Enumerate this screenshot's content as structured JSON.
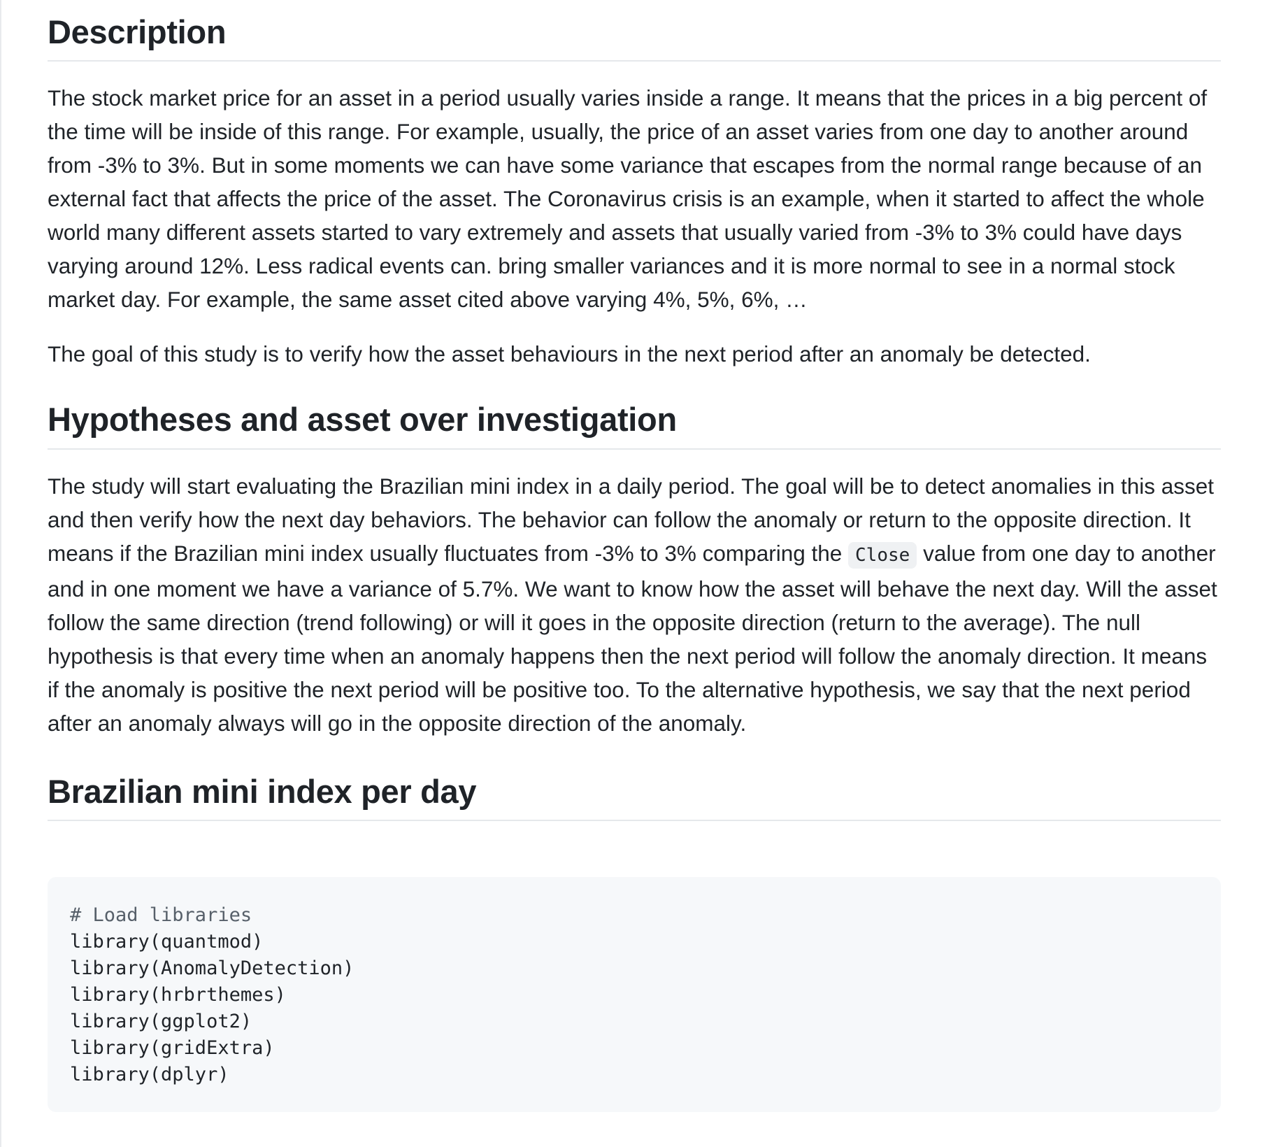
{
  "sections": {
    "description": {
      "title": "Description",
      "paragraphs": [
        "The stock market price for an asset in a period usually varies inside a range. It means that the prices in a big percent of the time will be inside of this range. For example, usually, the price of an asset varies from one day to another around from -3% to 3%. But in some moments we can have some variance that escapes from the normal range because of an external fact that affects the price of the asset. The Coronavirus crisis is an example, when it started to affect the whole world many different assets started to vary extremely and assets that usually varied from -3% to 3% could have days varying around 12%. Less radical events can. bring smaller variances and it is more normal to see in a normal stock market day. For example, the same asset cited above varying 4%, 5%, 6%, …",
        "The goal of this study is to verify how the asset behaviours in the next period after an anomaly be detected."
      ]
    },
    "hypotheses": {
      "title": "Hypotheses and asset over investigation",
      "paragraph_before_code": "The study will start evaluating the Brazilian mini index in a daily period. The goal will be to detect anomalies in this asset and then verify how the next day behaviors. The behavior can follow the anomaly or return to the opposite direction. It means if the Brazilian mini index usually fluctuates from -3% to 3% comparing the ",
      "inline_code": "Close",
      "paragraph_after_code": " value from one day to another and in one moment we have a variance of 5.7%. We want to know how the asset will behave the next day. Will the asset follow the same direction (trend following) or will it goes in the opposite direction (return to the average). The null hypothesis is that every time when an anomaly happens then the next period will follow the anomaly direction. It means if the anomaly is positive the next period will be positive too. To the alternative hypothesis, we say that the next period after an anomaly always will go in the opposite direction of the anomaly."
    },
    "mini_index": {
      "title": "Brazilian mini index per day",
      "code": {
        "comment": "# Load libraries",
        "lines": [
          "library(quantmod)",
          "library(AnomalyDetection)",
          "library(hrbrthemes)",
          "library(ggplot2)",
          "library(gridExtra)",
          "library(dplyr)"
        ]
      }
    }
  }
}
